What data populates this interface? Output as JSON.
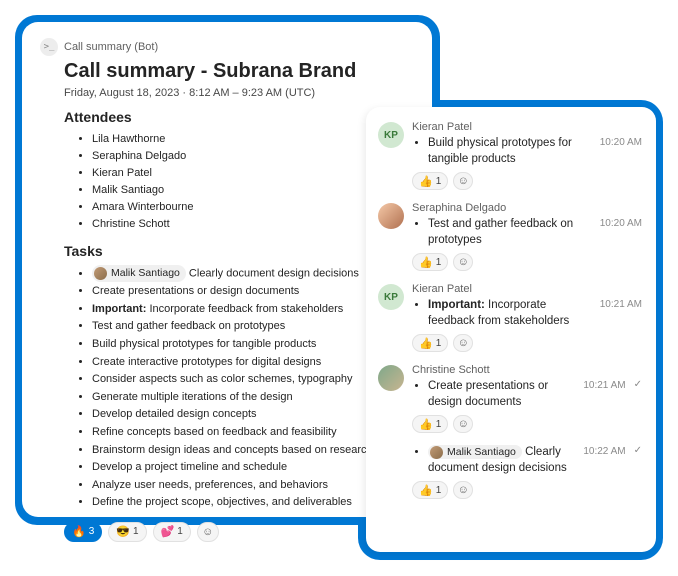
{
  "left": {
    "botLabel": "Call summary (Bot)",
    "botGlyph": ">_",
    "title": "Call summary - Subrana Brand",
    "datetime": "Friday, August 18, 2023   ·   8:12 AM – 9:23 AM (UTC)",
    "attendeesHeading": "Attendees",
    "attendees": [
      "Lila Hawthorne",
      "Seraphina Delgado",
      "Kieran Patel",
      "Malik Santiago",
      "Amara Winterbourne",
      "Christine Schott"
    ],
    "tasksHeading": "Tasks",
    "taskMention": "Malik Santiago",
    "taskMentionRest": " Clearly document design decisions",
    "tasks": [
      "Create presentations or design documents",
      {
        "bold": "Important:",
        "rest": " Incorporate feedback from stakeholders"
      },
      "Test and gather feedback on prototypes",
      "Build physical prototypes for tangible products",
      "Create interactive prototypes for digital designs",
      "Consider aspects such as color schemes, typography",
      "Generate multiple iterations of the design",
      "Develop detailed design concepts",
      "Refine concepts based on feedback and feasibility",
      "Brainstorm design ideas and concepts based on research",
      "Develop a project timeline and schedule",
      "Analyze user needs, preferences, and behaviors",
      "Define the project scope, objectives, and deliverables"
    ],
    "reactions": [
      {
        "emoji": "🔥",
        "count": "3",
        "active": true
      },
      {
        "emoji": "😎",
        "count": "1"
      },
      {
        "emoji": "💕",
        "count": "1"
      }
    ]
  },
  "right": {
    "messages": [
      {
        "sender": "Kieran Patel",
        "initials": "KP",
        "avatarClass": "kp",
        "text": "Build physical prototypes for tangible products",
        "time": "10:20 AM",
        "thumbCount": "1"
      },
      {
        "sender": "Seraphina Delgado",
        "avatarClass": "sd",
        "text": "Test and gather feedback on prototypes",
        "time": "10:20 AM",
        "thumbCount": "1"
      },
      {
        "sender": "Kieran Patel",
        "initials": "KP",
        "avatarClass": "kp",
        "bold": "Important:",
        "rest": " Incorporate feedback from stakeholders",
        "time": "10:21 AM",
        "thumbCount": "1"
      },
      {
        "sender": "Christine Schott",
        "avatarClass": "cs",
        "text": "Create presentations or design documents",
        "time": "10:21 AM",
        "check": true,
        "thumbCount": "1"
      },
      {
        "continued": true,
        "mention": "Malik Santiago",
        "rest": " Clearly document design decisions",
        "time": "10:22 AM",
        "check": true,
        "thumbCount": "1"
      }
    ]
  },
  "icons": {
    "addReaction": "☺"
  }
}
